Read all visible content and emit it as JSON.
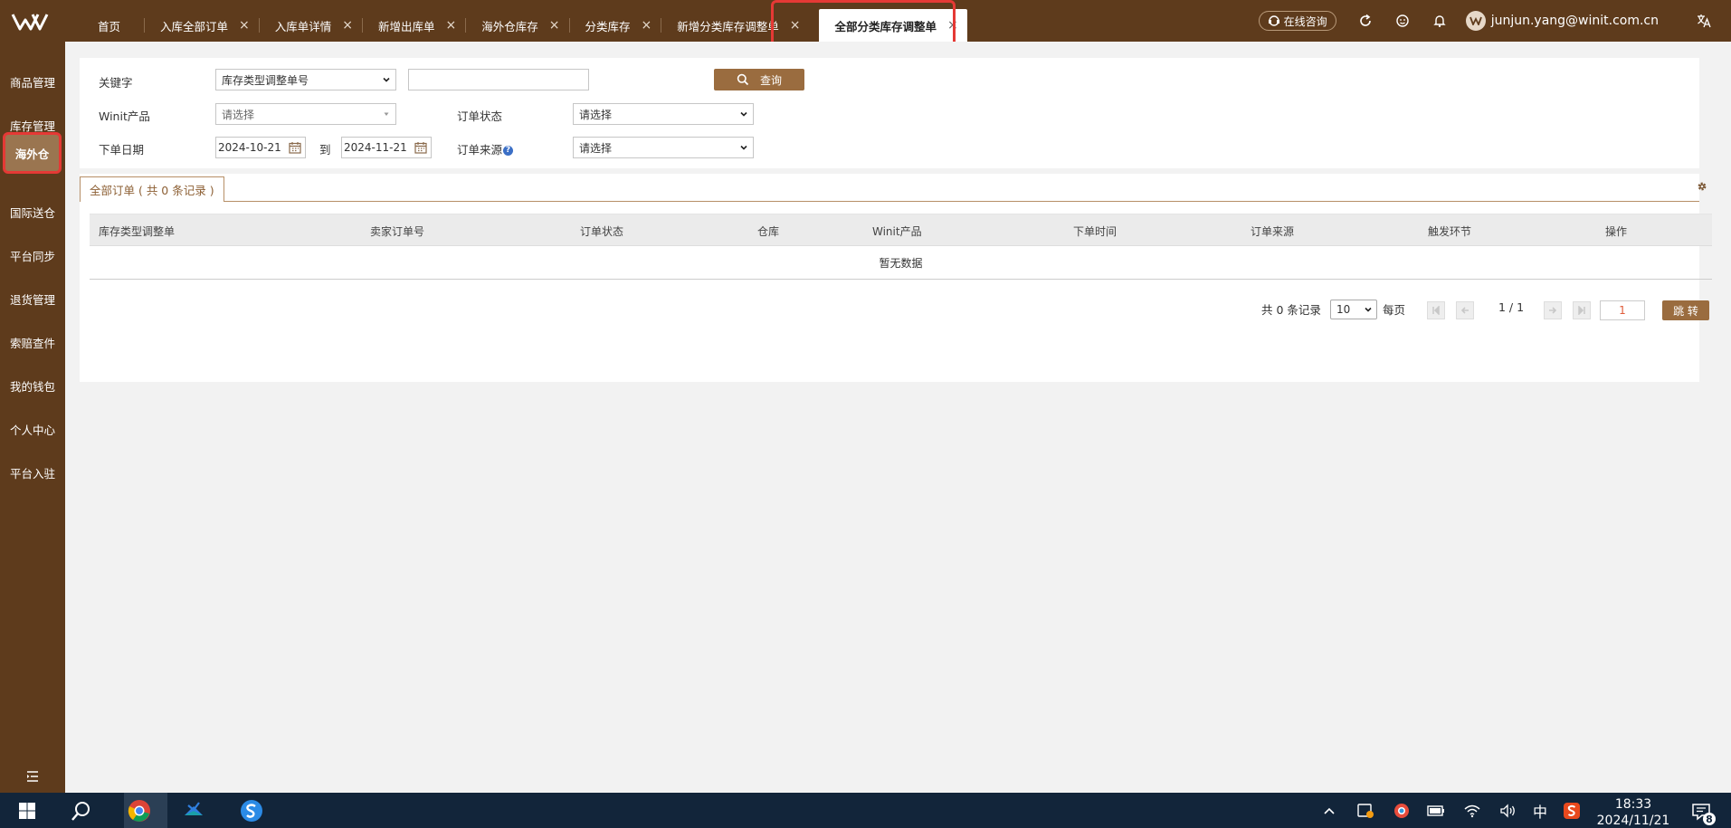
{
  "header": {
    "tabs": [
      {
        "label": "首页",
        "closable": false
      },
      {
        "label": "入库全部订单",
        "closable": true
      },
      {
        "label": "入库单详情",
        "closable": true
      },
      {
        "label": "新增出库单",
        "closable": true
      },
      {
        "label": "海外仓库存",
        "closable": true
      },
      {
        "label": "分类库存",
        "closable": true
      },
      {
        "label": "新增分类库存调整单",
        "closable": true
      },
      {
        "label": "全部分类库存调整单",
        "closable": true,
        "active": true
      }
    ],
    "close_glyph": "×",
    "consult_label": "在线咨询",
    "user_email": "junjun.yang@winit.com.cn",
    "brand_color": "#5e3b1c",
    "accent_color": "#9a6c3f"
  },
  "sidebar": {
    "items": [
      {
        "label": "商品管理"
      },
      {
        "label": "库存管理"
      },
      {
        "label": "海外仓",
        "active": true
      },
      {
        "label": "国际送仓"
      },
      {
        "label": "平台同步"
      },
      {
        "label": "退货管理"
      },
      {
        "label": "索赔查件"
      },
      {
        "label": "我的钱包"
      },
      {
        "label": "个人中心"
      },
      {
        "label": "平台入驻"
      }
    ]
  },
  "filters": {
    "keyword_label": "关键字",
    "keyword_type_value": "库存类型调整单号",
    "keyword_value": "",
    "search_button": "查询",
    "product_label": "Winit产品",
    "product_placeholder": "请选择",
    "order_status_label": "订单状态",
    "order_status_value": "请选择",
    "order_date_label": "下单日期",
    "date_from": "2024-10-21",
    "date_to_label": "到",
    "date_to": "2024-11-21",
    "order_source_label": "订单来源",
    "order_source_help": "?",
    "order_source_value": "请选择"
  },
  "list": {
    "tab_label": "全部订单 ( 共 0 条记录 )",
    "columns": [
      "库存类型调整单",
      "卖家订单号",
      "订单状态",
      "仓库",
      "Winit产品",
      "下单时间",
      "订单来源",
      "触发环节",
      "操作"
    ],
    "rows": [],
    "empty_text": "暂无数据"
  },
  "pagination": {
    "total_text": "共 0 条记录",
    "page_size": "10",
    "per_page_label": "每页",
    "page_info": "1 / 1",
    "jump_value": "1",
    "jump_button": "跳 转"
  },
  "taskbar": {
    "ime_label": "中",
    "time": "18:33",
    "date": "2024/11/21",
    "notification_count": "8"
  }
}
